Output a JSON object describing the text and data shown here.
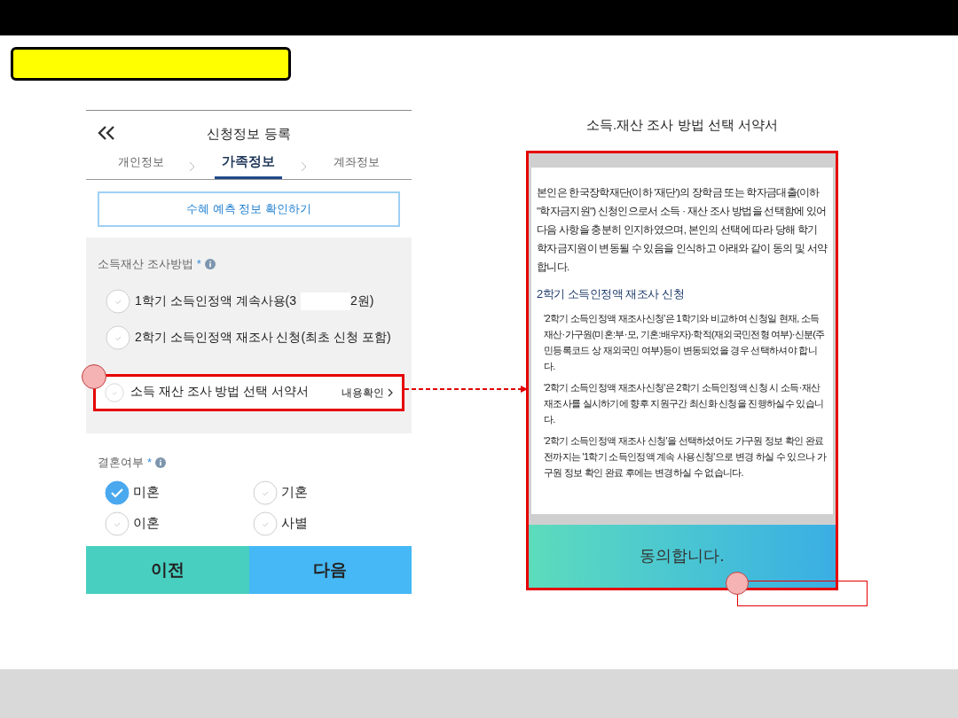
{
  "form": {
    "title": "신청정보 등록",
    "steps": [
      {
        "label": "개인정보",
        "selected": false
      },
      {
        "label": "가족정보",
        "selected": true
      },
      {
        "label": "계좌정보",
        "selected": false
      }
    ],
    "benefit_button": "수혜 예측 정보 확인하기",
    "income_method": {
      "label": "소득재산 조사방법",
      "required": "*",
      "options": [
        {
          "parts": [
            "1학기 소득인정액 계속사용(3",
            "2원)"
          ],
          "selected": false
        },
        {
          "parts": [
            "2학기 소득인정액 재조사 신청(최초 신청 포함)"
          ],
          "selected": false
        }
      ]
    },
    "pledge": {
      "label": "소득 재산 조사 방법 선택 서약서",
      "checked": false,
      "link": "내용확인"
    },
    "marriage": {
      "label": "결혼여부",
      "required": "*",
      "options": [
        {
          "label": "미혼",
          "selected": true
        },
        {
          "label": "기혼",
          "selected": false
        },
        {
          "label": "이혼",
          "selected": false
        },
        {
          "label": "사별",
          "selected": false
        }
      ]
    },
    "prev_button": "이전",
    "next_button": "다음"
  },
  "document": {
    "title": "소득.재산 조사 방법 선택 서약서",
    "intro": "본인은 한국장학재단(이하 '재단')의 장학금 또는 학자금대출(이하 \"학자금지원\") 신청인으로서 소득 · 재산 조사 방법을 선택함에 있어 다음 사항을 충분히 인지하였으며, 본인의 선택에 따라 당해 학기 학자금지원이 변동될 수 있음을 인식하고 아래와 같이 동의 및 서약합니다.",
    "heading": "2학기 소득인정액 재조사 신청",
    "paragraphs": [
      "'2학기 소득인정액 재조사신청'은 1학기와 비교하여 신청일 현재, 소득재산·가구원(미혼:부·모, 기혼:배우자)·학적(재외국민전형 여부)·신분(주민등록코드 상 재외국민 여부)등이 변동되었을 경우 선택하셔야 합니다.",
      "'2학기 소득인정액 재조사신청'은 2학기 소득인정액 신청 시 소득·재산 재조사를 실시하기에 향후 지원구간 최신화 신청을 진행하실수 있습니다.",
      "'2학기 소득인정액 재조사 신청'을 선택하셨어도 가구원 정보 확인 완료 전까지는 '1학기 소득인정액 계속 사용신청'으로 변경 하실 수 있으나 가구원 정보 확인 완료 후에는 변경하실 수 없습니다."
    ],
    "agree_button": "동의합니다."
  }
}
